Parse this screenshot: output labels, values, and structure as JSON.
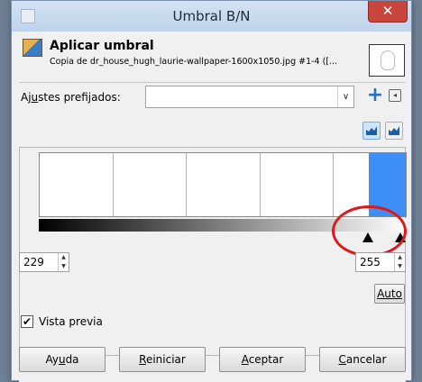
{
  "window": {
    "title": "Umbral B/N",
    "close_glyph": "✕"
  },
  "header": {
    "tool_name": "Aplicar umbral",
    "subtitle": "Copia de dr_house_hugh_laurie-wallpaper-1600x1050.jpg #1-4 ([..."
  },
  "presets": {
    "label_before": "Aj",
    "label_mnemonic": "u",
    "label_after": "stes prefijados:",
    "value": "",
    "arrow": "∨",
    "add_glyph": "+",
    "menu_glyph": "◂"
  },
  "threshold": {
    "low": "229",
    "high": "255",
    "low_fraction": 0.898,
    "high_fraction": 1.0
  },
  "auto_label": "Auto",
  "preview": {
    "label": "Vista previa",
    "checked": true,
    "check_glyph": "✔"
  },
  "buttons": {
    "help": {
      "before": "Ay",
      "mnemonic": "u",
      "after": "da"
    },
    "reset": {
      "before": "",
      "mnemonic": "R",
      "after": "einiciar"
    },
    "accept": {
      "before": "",
      "mnemonic": "A",
      "after": "ceptar"
    },
    "cancel": {
      "before": "",
      "mnemonic": "C",
      "after": "ancelar"
    }
  },
  "colors": {
    "selection": "#3d8ef7",
    "highlight": "#e0181a",
    "close": "#c9463d"
  },
  "icons": {
    "tool": "threshold-tool-icon",
    "thumbnail": "image-thumbnail",
    "add": "plus-icon",
    "menu": "menu-arrow-icon",
    "linear": "linear-histogram-icon",
    "log": "log-histogram-icon",
    "handle": "triangle-up-icon"
  }
}
